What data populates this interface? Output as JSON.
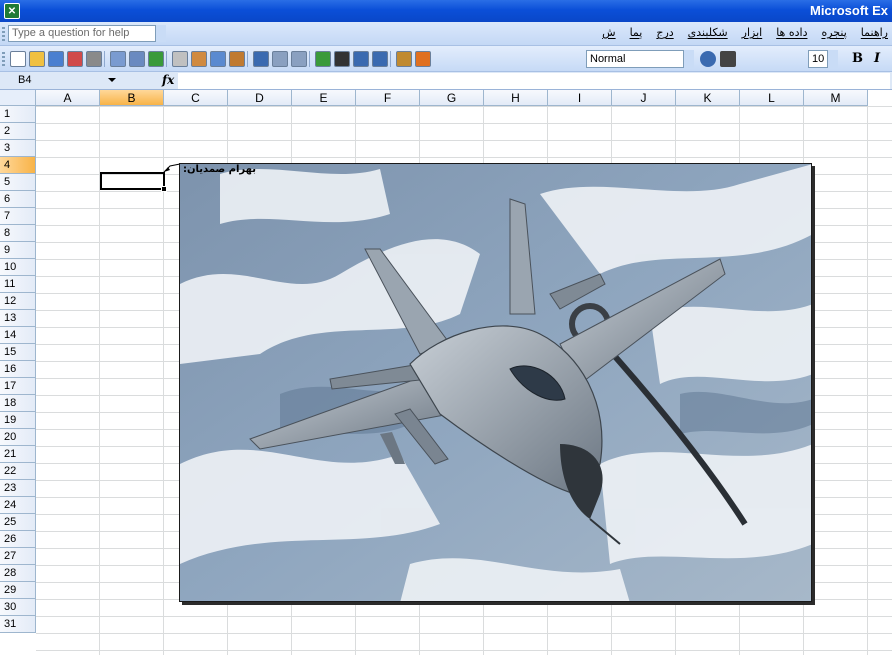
{
  "window": {
    "title": "Microsoft Ex"
  },
  "menu": {
    "help_placeholder": "Type a question for help",
    "items": [
      "ش",
      "پما",
      "درج",
      "شکلبندی",
      "ابزار",
      "داده ها",
      "پنجره",
      "راهنما"
    ]
  },
  "toolbar": {
    "style_value": "Normal",
    "font_size": "10",
    "bold_label": "B",
    "italic_label": "I"
  },
  "formula_bar": {
    "name_box": "B4",
    "fx_label": "fx",
    "formula": ""
  },
  "columns": [
    "A",
    "B",
    "C",
    "D",
    "E",
    "F",
    "G",
    "H",
    "I",
    "J",
    "K",
    "L",
    "M"
  ],
  "rows": [
    "1",
    "2",
    "3",
    "4",
    "5",
    "6",
    "7",
    "8",
    "9",
    "10",
    "11",
    "12",
    "13",
    "14",
    "15",
    "16",
    "17",
    "18",
    "19",
    "20",
    "21",
    "22",
    "23",
    "24",
    "25",
    "26",
    "27",
    "28",
    "29",
    "30",
    "31"
  ],
  "selected": {
    "column": "B",
    "row": "4"
  },
  "comment": {
    "text": "بهرام صمدیان:"
  },
  "picture": {
    "subject": "fighter jet refueling over snowy landscape"
  },
  "colors": {
    "accent": "#0b4fd8",
    "selection": "#f8b348"
  }
}
